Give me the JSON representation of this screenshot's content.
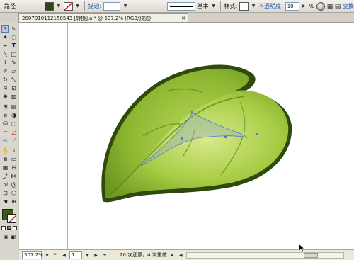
{
  "controlbar": {
    "object_type": "路径",
    "stroke_label": "描边:",
    "stroke_weight": "",
    "profile_label": "基本",
    "style_label": "样式:",
    "opacity_label": "不透明度:",
    "opacity_value": "10",
    "percent": "%",
    "last_label": "变换",
    "fill_color": "#2f4a10"
  },
  "document": {
    "tab_title": "2007910112158543 [转换].ai* @ 507.2% (RGB/预览)"
  },
  "toolbox": {
    "fill_color": "#3a5a12",
    "tools": [
      "selection-tool",
      "direct-selection-tool",
      "magic-wand-tool",
      "lasso-tool",
      "pen-tool",
      "type-tool",
      "line-tool",
      "rectangle-tool",
      "paintbrush-tool",
      "pencil-tool",
      "blob-brush-tool",
      "eraser-tool",
      "rotate-tool",
      "scale-tool",
      "warp-tool",
      "free-transform-tool",
      "symbol-sprayer-tool",
      "graph-tool",
      "mesh-tool",
      "gradient-tool",
      "eyedropper-tool",
      "blend-tool",
      "live-paint-tool",
      "live-paint-select-tool",
      "crop-tool",
      "slice-tool",
      "scissors-tool",
      "knife-tool",
      "hand-tool",
      "zoom-tool"
    ]
  },
  "statusbar": {
    "zoom": "507.2%",
    "page": "1",
    "undo_text": "20 次还原，4 次重做"
  }
}
